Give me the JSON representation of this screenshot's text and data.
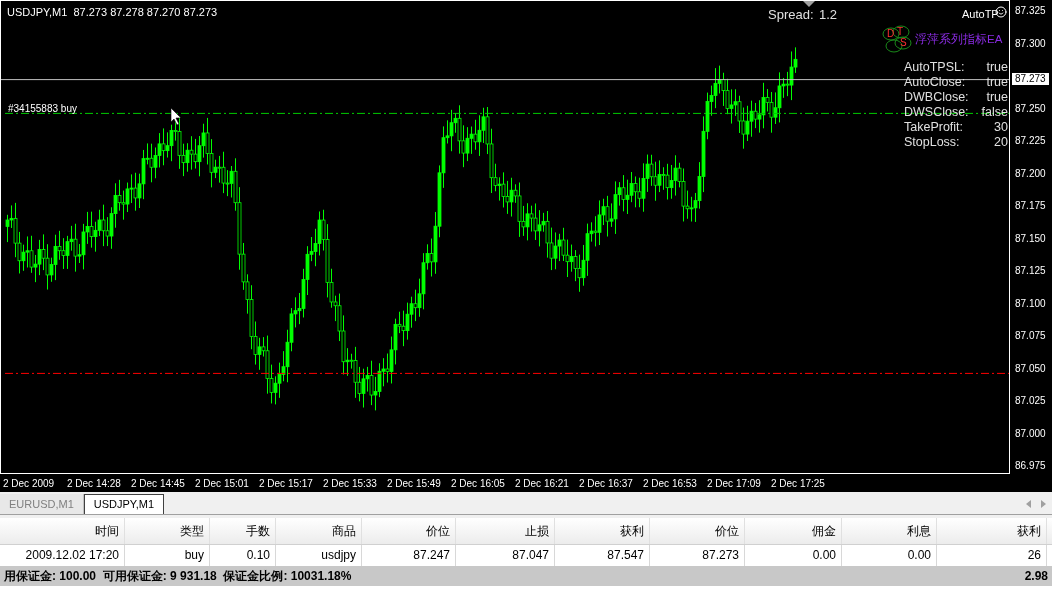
{
  "chart": {
    "symbol_info": "USDJPY,M1  87.273 87.278 87.270 87.273",
    "spread_label": "Spread:",
    "spread_value": "1.2",
    "ea_name": "AutoTP",
    "logo_letters": [
      "D",
      "T",
      "S"
    ],
    "logo_text": "浮萍系列指标EA",
    "settings": [
      {
        "name": "AutoTPSL:",
        "value": "true"
      },
      {
        "name": "AutoClose:",
        "value": "true"
      },
      {
        "name": "DWBClose:",
        "value": "true"
      },
      {
        "name": "DWSClose:",
        "value": "false"
      },
      {
        "name": "TakeProfit:",
        "value": "30"
      },
      {
        "name": "StopLoss:",
        "value": "20"
      }
    ],
    "order_label": "#34155883 buy",
    "current_price": "87.273",
    "price_ticks": [
      "87.325",
      "87.300",
      "87.250",
      "87.225",
      "87.200",
      "87.175",
      "87.150",
      "87.125",
      "87.100",
      "87.075",
      "87.050",
      "87.025",
      "87.000",
      "86.975"
    ],
    "time_labels": [
      "2 Dec 2009",
      "2 Dec 14:28",
      "2 Dec 14:45",
      "2 Dec 15:01",
      "2 Dec 15:17",
      "2 Dec 15:33",
      "2 Dec 15:49",
      "2 Dec 16:05",
      "2 Dec 16:21",
      "2 Dec 16:37",
      "2 Dec 16:53",
      "2 Dec 17:09",
      "2 Dec 17:25"
    ]
  },
  "tabs": [
    {
      "label": "EURUSD,M1",
      "selected": false
    },
    {
      "label": "USDJPY,M1",
      "selected": true
    }
  ],
  "table": {
    "columns": [
      "时间",
      "类型",
      "手数",
      "商品",
      "价位",
      "止损",
      "获利",
      "价位",
      "佣金",
      "利息",
      "获利"
    ],
    "rows": [
      [
        "2009.12.02 17:20",
        "buy",
        "0.10",
        "usdjpy",
        "87.247",
        "87.047",
        "87.547",
        "87.273",
        "0.00",
        "0.00",
        "26"
      ]
    ],
    "summary": {
      "text": "用保证金: 100.00  可用保证金: 9 931.18  保证金比例: 10031.18%",
      "total": "2.98"
    }
  }
}
